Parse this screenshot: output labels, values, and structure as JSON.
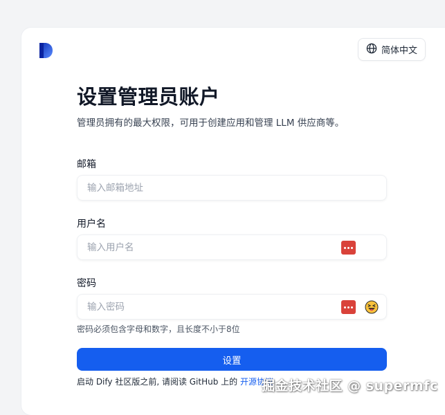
{
  "header": {
    "language_label": "简体中文",
    "globe_icon": "globe-icon",
    "logo_icon": "dify-logo-icon"
  },
  "main": {
    "title": "设置管理员账户",
    "subtitle": "管理员拥有的最大权限，可用于创建应用和管理 LLM 供应商等。"
  },
  "form": {
    "email": {
      "label": "邮箱",
      "placeholder": "输入邮箱地址",
      "value": ""
    },
    "username": {
      "label": "用户名",
      "placeholder": "输入用户名",
      "value": "",
      "extension_icon": "password-manager-icon"
    },
    "password": {
      "label": "密码",
      "placeholder": "输入密码",
      "value": "",
      "extension_icon": "password-manager-icon",
      "toggle_icon": "emoji-face-icon",
      "hint": "密码必须包含字母和数字，且长度不小于8位"
    },
    "submit_label": "设置"
  },
  "footer": {
    "note_prefix": "启动 Dify 社区版之前, 请阅读 GitHub 上的 ",
    "note_link": "开源协议"
  },
  "watermark": "掘金技术社区 @ supermfc",
  "colors": {
    "primary": "#155eef",
    "password_manager_red": "#d9423a",
    "text_primary": "#111827",
    "placeholder": "#9ca3af"
  }
}
